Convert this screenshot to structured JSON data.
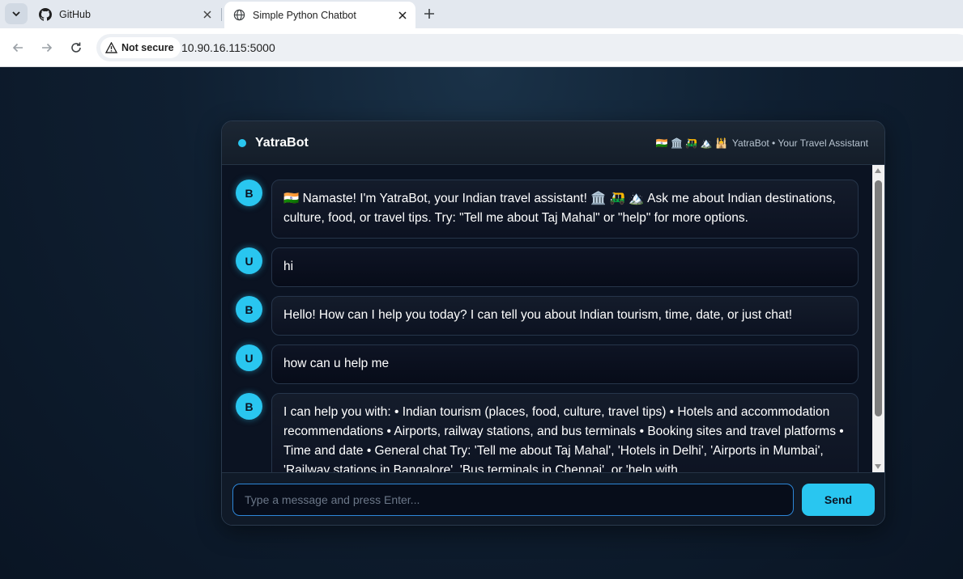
{
  "browser": {
    "tabs": [
      {
        "title": "GitHub",
        "icon": "github-icon",
        "active": false
      },
      {
        "title": "Simple Python Chatbot",
        "icon": "globe-icon",
        "active": true
      }
    ],
    "security_label": "Not secure",
    "url": "10.90.16.115:5000"
  },
  "chat": {
    "title": "YatraBot",
    "subtitle_emoji": "🇮🇳 🏛️ 🛺 🏔️ 🕌",
    "subtitle": "YatraBot • Your Travel Assistant",
    "messages": [
      {
        "role": "bot",
        "avatar": "B",
        "text": "🇮🇳 Namaste! I'm YatraBot, your Indian travel assistant! 🏛️ 🛺 🏔️ Ask me about Indian destinations, culture, food, or travel tips. Try: \"Tell me about Taj Mahal\" or \"help\" for more options."
      },
      {
        "role": "user",
        "avatar": "U",
        "text": "hi"
      },
      {
        "role": "bot",
        "avatar": "B",
        "text": "Hello! How can I help you today? I can tell you about Indian tourism, time, date, or just chat!"
      },
      {
        "role": "user",
        "avatar": "U",
        "text": "how can u help me"
      },
      {
        "role": "bot",
        "avatar": "B",
        "text": "I can help you with: • Indian tourism (places, food, culture, travel tips) • Hotels and accommodation recommendations • Airports, railway stations, and bus terminals • Booking sites and travel platforms • Time and date • General chat Try: 'Tell me about Taj Mahal', 'Hotels in Delhi', 'Airports in Mumbai', 'Railway stations in Bangalore', 'Bus terminals in Chennai', or 'help with"
      }
    ],
    "input_placeholder": "Type a message and press Enter...",
    "input_value": "",
    "send_label": "Send"
  },
  "colors": {
    "accent": "#29c6f0",
    "page_bg": "#0e1a2a",
    "panel_bg": "#0b1322"
  }
}
